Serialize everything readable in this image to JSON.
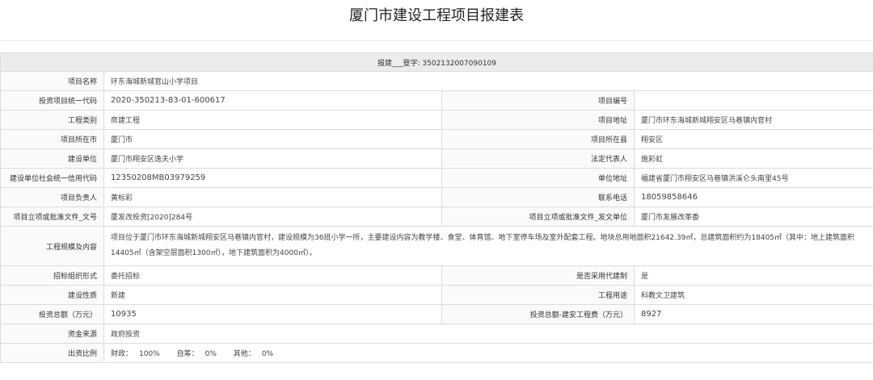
{
  "title": "厦门市建设工程项目报建表",
  "registration": "报建___登字: 3502132007090109",
  "project": {
    "name_label": "项目名称",
    "name": "环东海城新城官山小学项目",
    "code_label": "投资项目统一代码",
    "code": "2020-350213-83-01-600617",
    "number_label": "项目编号",
    "number": "",
    "category_label": "工程类别",
    "category": "房建工程",
    "address_label": "项目地址",
    "address": "厦门市环东海城新城翔安区马巷镇内官村",
    "city_label": "项目所在市",
    "city": "厦门市",
    "county_label": "项目所在县",
    "county": "翔安区",
    "builder_label": "建设单位",
    "builder": "厦门市翔安区逸夫小学",
    "legal_rep_label": "法定代表人",
    "legal_rep": "施彩虹",
    "credit_code_label": "建设单位社会统一信用代码",
    "credit_code": "12350208MB03979259",
    "unit_address_label": "单位地址",
    "unit_address": "福建省厦门市翔安区马巷镇洪溪仑头南里45号",
    "manager_label": "项目负责人",
    "manager": "黄标彩",
    "phone_label": "联系电话",
    "phone": "18059858646",
    "approval_doc_label": "项目立项或批准文件_文号",
    "approval_doc": "厦发改投资[2020]284号",
    "approval_unit_label": "项目立项或批准文件_发文单位",
    "approval_unit": "厦门市发展改革委",
    "scope_label": "工程规模及内容",
    "scope": "项目位于厦门市环东海城新城翔安区马巷镇内官村，建设规模为36班小学一所，主要建设内容为教学楼、食堂、体育馆、地下室停车场及室外配套工程。地块总用地面积21642.39㎡，总建筑面积约为18405㎡（其中：地上建筑面积14405㎡（含架空层面积1300㎡），地下建筑面积为4000㎡）。",
    "bidding_label": "招标组织形式",
    "bidding": "委托招标",
    "agent_label": "是否采用代建制",
    "agent": "是",
    "nature_label": "建设性质",
    "nature": "新建",
    "usage_label": "工程用途",
    "usage": "科教文卫建筑",
    "investment_label": "投资总额（万元）",
    "investment": "10935",
    "construction_cost_label": "投资总额-建安工程费（万元）",
    "construction_cost": "8927",
    "funding_label": "资金来源",
    "funding": "政府投资",
    "ratio_label": "出资比例",
    "ratio": {
      "fiscal_label": "财政：",
      "fiscal": "100%",
      "self_label": "自筹：",
      "self": "0%",
      "other_label": "其他：",
      "other": "0%"
    }
  }
}
